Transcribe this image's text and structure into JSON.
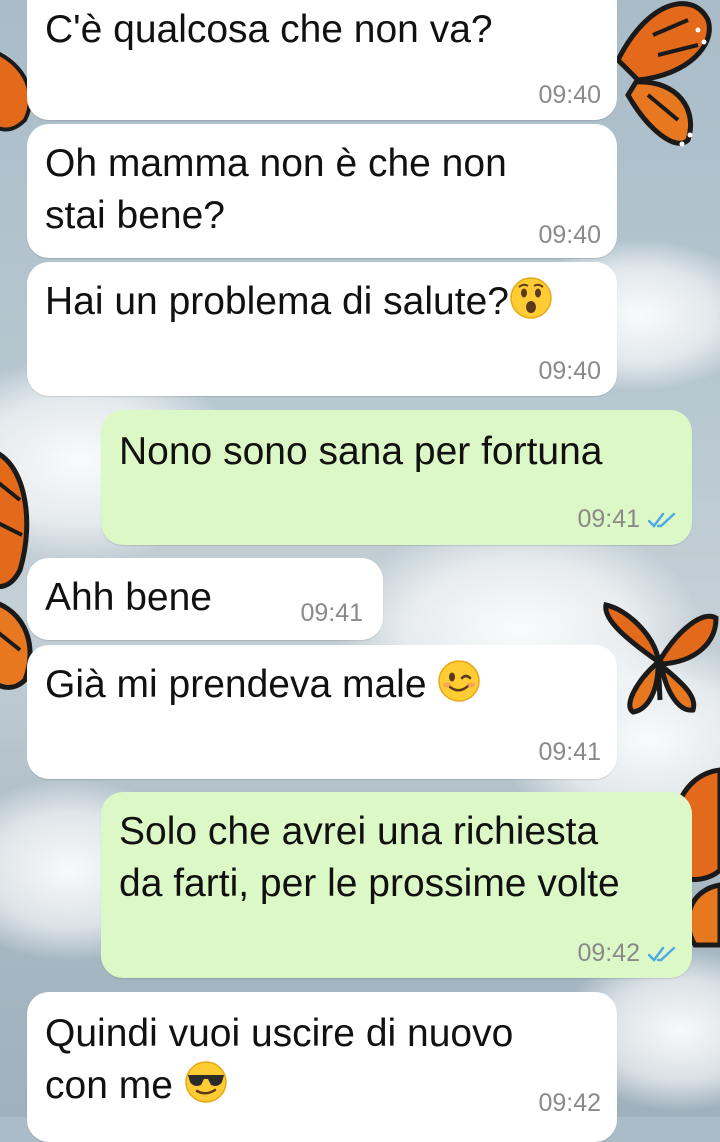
{
  "messages": [
    {
      "direction": "incoming",
      "text": "C'è qualcosa che non va?",
      "time": "09:40"
    },
    {
      "direction": "incoming",
      "text_line1": "Oh mamma non è che non",
      "text_line2": "stai bene?",
      "time": "09:40"
    },
    {
      "direction": "incoming",
      "text": "Hai un problema di salute?",
      "emoji": "astonished-face-emoji",
      "time": "09:40"
    },
    {
      "direction": "outgoing",
      "text": "Nono sono sana per fortuna",
      "time": "09:41",
      "status": "read"
    },
    {
      "direction": "incoming",
      "text": "Ahh bene",
      "time": "09:41"
    },
    {
      "direction": "incoming",
      "text": "Già mi prendeva male ",
      "emoji": "winking-face-emoji",
      "time": "09:41"
    },
    {
      "direction": "outgoing",
      "text_line1": "Solo che avrei una richiesta",
      "text_line2": "da farti, per le prossime volte",
      "time": "09:42",
      "status": "read"
    },
    {
      "direction": "incoming",
      "text_line1": "Quindi vuoi uscire di nuovo",
      "text_line2": "con me ",
      "emoji": "sunglasses-face-emoji",
      "time": "09:42"
    }
  ],
  "colors": {
    "incoming_bubble": "#ffffff",
    "outgoing_bubble": "#dcf8c6",
    "read_ticks": "#4fa8e8",
    "timestamp": "#8a8a8a"
  }
}
